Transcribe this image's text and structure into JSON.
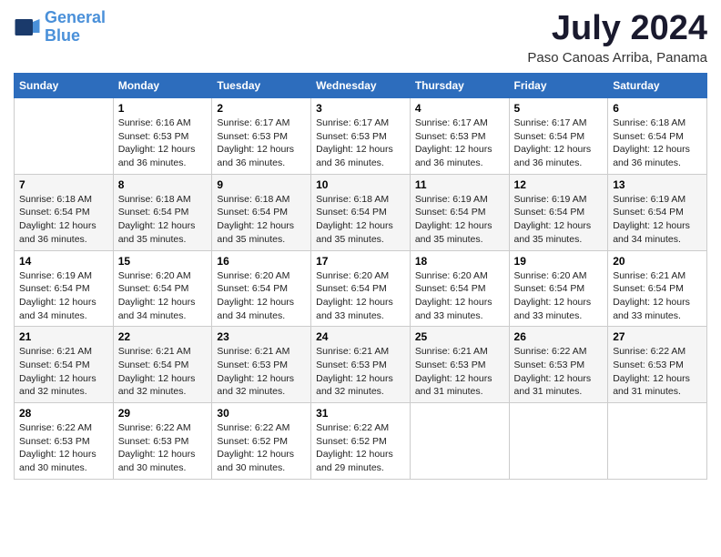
{
  "header": {
    "logo_line1": "General",
    "logo_line2": "Blue",
    "month_year": "July 2024",
    "location": "Paso Canoas Arriba, Panama"
  },
  "days_of_week": [
    "Sunday",
    "Monday",
    "Tuesday",
    "Wednesday",
    "Thursday",
    "Friday",
    "Saturday"
  ],
  "weeks": [
    [
      {
        "day": "",
        "info": ""
      },
      {
        "day": "1",
        "info": "Sunrise: 6:16 AM\nSunset: 6:53 PM\nDaylight: 12 hours\nand 36 minutes."
      },
      {
        "day": "2",
        "info": "Sunrise: 6:17 AM\nSunset: 6:53 PM\nDaylight: 12 hours\nand 36 minutes."
      },
      {
        "day": "3",
        "info": "Sunrise: 6:17 AM\nSunset: 6:53 PM\nDaylight: 12 hours\nand 36 minutes."
      },
      {
        "day": "4",
        "info": "Sunrise: 6:17 AM\nSunset: 6:53 PM\nDaylight: 12 hours\nand 36 minutes."
      },
      {
        "day": "5",
        "info": "Sunrise: 6:17 AM\nSunset: 6:54 PM\nDaylight: 12 hours\nand 36 minutes."
      },
      {
        "day": "6",
        "info": "Sunrise: 6:18 AM\nSunset: 6:54 PM\nDaylight: 12 hours\nand 36 minutes."
      }
    ],
    [
      {
        "day": "7",
        "info": "Sunrise: 6:18 AM\nSunset: 6:54 PM\nDaylight: 12 hours\nand 36 minutes."
      },
      {
        "day": "8",
        "info": "Sunrise: 6:18 AM\nSunset: 6:54 PM\nDaylight: 12 hours\nand 35 minutes."
      },
      {
        "day": "9",
        "info": "Sunrise: 6:18 AM\nSunset: 6:54 PM\nDaylight: 12 hours\nand 35 minutes."
      },
      {
        "day": "10",
        "info": "Sunrise: 6:18 AM\nSunset: 6:54 PM\nDaylight: 12 hours\nand 35 minutes."
      },
      {
        "day": "11",
        "info": "Sunrise: 6:19 AM\nSunset: 6:54 PM\nDaylight: 12 hours\nand 35 minutes."
      },
      {
        "day": "12",
        "info": "Sunrise: 6:19 AM\nSunset: 6:54 PM\nDaylight: 12 hours\nand 35 minutes."
      },
      {
        "day": "13",
        "info": "Sunrise: 6:19 AM\nSunset: 6:54 PM\nDaylight: 12 hours\nand 34 minutes."
      }
    ],
    [
      {
        "day": "14",
        "info": "Sunrise: 6:19 AM\nSunset: 6:54 PM\nDaylight: 12 hours\nand 34 minutes."
      },
      {
        "day": "15",
        "info": "Sunrise: 6:20 AM\nSunset: 6:54 PM\nDaylight: 12 hours\nand 34 minutes."
      },
      {
        "day": "16",
        "info": "Sunrise: 6:20 AM\nSunset: 6:54 PM\nDaylight: 12 hours\nand 34 minutes."
      },
      {
        "day": "17",
        "info": "Sunrise: 6:20 AM\nSunset: 6:54 PM\nDaylight: 12 hours\nand 33 minutes."
      },
      {
        "day": "18",
        "info": "Sunrise: 6:20 AM\nSunset: 6:54 PM\nDaylight: 12 hours\nand 33 minutes."
      },
      {
        "day": "19",
        "info": "Sunrise: 6:20 AM\nSunset: 6:54 PM\nDaylight: 12 hours\nand 33 minutes."
      },
      {
        "day": "20",
        "info": "Sunrise: 6:21 AM\nSunset: 6:54 PM\nDaylight: 12 hours\nand 33 minutes."
      }
    ],
    [
      {
        "day": "21",
        "info": "Sunrise: 6:21 AM\nSunset: 6:54 PM\nDaylight: 12 hours\nand 32 minutes."
      },
      {
        "day": "22",
        "info": "Sunrise: 6:21 AM\nSunset: 6:54 PM\nDaylight: 12 hours\nand 32 minutes."
      },
      {
        "day": "23",
        "info": "Sunrise: 6:21 AM\nSunset: 6:53 PM\nDaylight: 12 hours\nand 32 minutes."
      },
      {
        "day": "24",
        "info": "Sunrise: 6:21 AM\nSunset: 6:53 PM\nDaylight: 12 hours\nand 32 minutes."
      },
      {
        "day": "25",
        "info": "Sunrise: 6:21 AM\nSunset: 6:53 PM\nDaylight: 12 hours\nand 31 minutes."
      },
      {
        "day": "26",
        "info": "Sunrise: 6:22 AM\nSunset: 6:53 PM\nDaylight: 12 hours\nand 31 minutes."
      },
      {
        "day": "27",
        "info": "Sunrise: 6:22 AM\nSunset: 6:53 PM\nDaylight: 12 hours\nand 31 minutes."
      }
    ],
    [
      {
        "day": "28",
        "info": "Sunrise: 6:22 AM\nSunset: 6:53 PM\nDaylight: 12 hours\nand 30 minutes."
      },
      {
        "day": "29",
        "info": "Sunrise: 6:22 AM\nSunset: 6:53 PM\nDaylight: 12 hours\nand 30 minutes."
      },
      {
        "day": "30",
        "info": "Sunrise: 6:22 AM\nSunset: 6:52 PM\nDaylight: 12 hours\nand 30 minutes."
      },
      {
        "day": "31",
        "info": "Sunrise: 6:22 AM\nSunset: 6:52 PM\nDaylight: 12 hours\nand 29 minutes."
      },
      {
        "day": "",
        "info": ""
      },
      {
        "day": "",
        "info": ""
      },
      {
        "day": "",
        "info": ""
      }
    ]
  ]
}
